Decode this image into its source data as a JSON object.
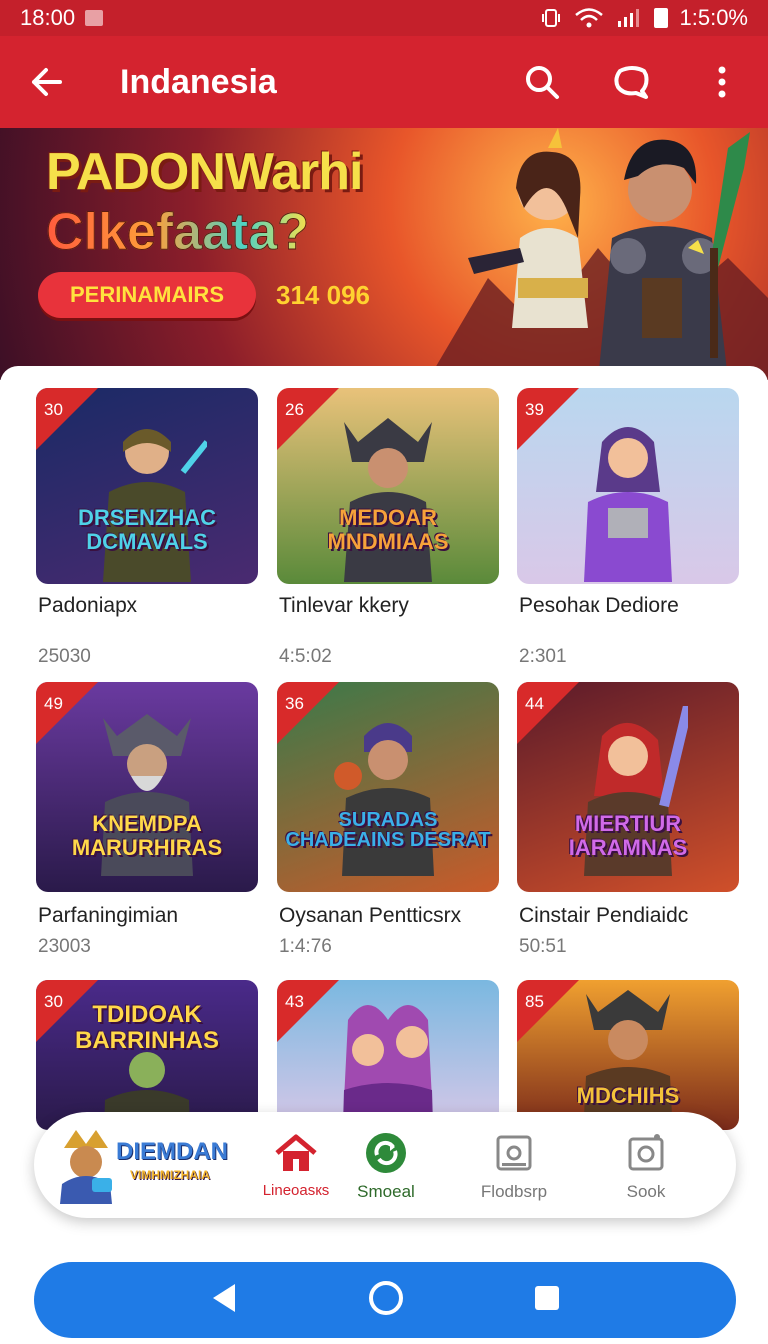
{
  "status": {
    "time": "18:00",
    "battery": "1:5:0%"
  },
  "header": {
    "title": "Indanesia"
  },
  "banner": {
    "headline": "PADONWarhi",
    "subheadline": "Clkefaata?",
    "button_label": "PERINAMAIRS",
    "count": "314 096"
  },
  "games": [
    {
      "badge": "30",
      "logo": "DRSENZHAC DCMAVALS",
      "name": "Padoniaрх",
      "meta": "25030",
      "bg": [
        "#1a2a66",
        "#4a2a70"
      ],
      "accent": "#4fd2e8"
    },
    {
      "badge": "26",
      "logo": "MEDOAR MNDMIAAS",
      "name": "Tinlevar kkery",
      "meta": "4:5:02",
      "bg": [
        "#e9c27a",
        "#5a8a3a"
      ],
      "accent": "#f27a2a"
    },
    {
      "badge": "39",
      "logo": "",
      "name": "Pesohак Dediore",
      "meta": "2:301",
      "bg": [
        "#b9d7ef",
        "#7a5aa0"
      ],
      "accent": "#8a4ad0"
    },
    {
      "badge": "49",
      "logo": "KNEMDPA MARURHIRAS",
      "name": "Parfaningimian",
      "meta": "23003",
      "bg": [
        "#6a3aa0",
        "#2a1a4a"
      ],
      "accent": "#f4c23a"
    },
    {
      "badge": "36",
      "logo": "SURADAS CHADEAINS DESRAT",
      "name": "Oysanan Penttiсsrx",
      "meta": "1:4:76",
      "bg": [
        "#3a7a4a",
        "#c95a2a"
      ],
      "accent": "#3ab0e8"
    },
    {
      "badge": "44",
      "logo": "MIERTIUR IARAMNAS",
      "name": "Cinstair Pendiaidc",
      "meta": "50:51",
      "bg": [
        "#5a1a2a",
        "#d0502a"
      ],
      "accent": "#b04ad0"
    },
    {
      "badge": "30",
      "logo": "TDIDOAK BARRINHAS",
      "name": "",
      "meta": "",
      "bg": [
        "#4a2a8a",
        "#2a1a4a"
      ],
      "accent": "#3ab04a"
    },
    {
      "badge": "43",
      "logo": "",
      "name": "",
      "meta": "",
      "bg": [
        "#7ab8e0",
        "#a04ab0"
      ],
      "accent": "#c04ad0"
    },
    {
      "badge": "85",
      "logo": "MDCHIHS",
      "name": "",
      "meta": "",
      "bg": [
        "#f0a030",
        "#7a2a1a"
      ],
      "accent": "#f4c23a"
    }
  ],
  "dock": {
    "brand_title": "DIEMDAN",
    "brand_sub": "VIMHMIZHAIA",
    "items": [
      {
        "label": "Lineoasкs",
        "icon": "home-icon",
        "color": "#d4232f"
      },
      {
        "label": "Smoeal",
        "icon": "refresh-icon",
        "color": "#2e8a3a"
      },
      {
        "label": "Flodbsrp",
        "icon": "frame-icon",
        "color": "#888888"
      },
      {
        "label": "Sook",
        "icon": "camera-icon",
        "color": "#888888"
      }
    ]
  }
}
